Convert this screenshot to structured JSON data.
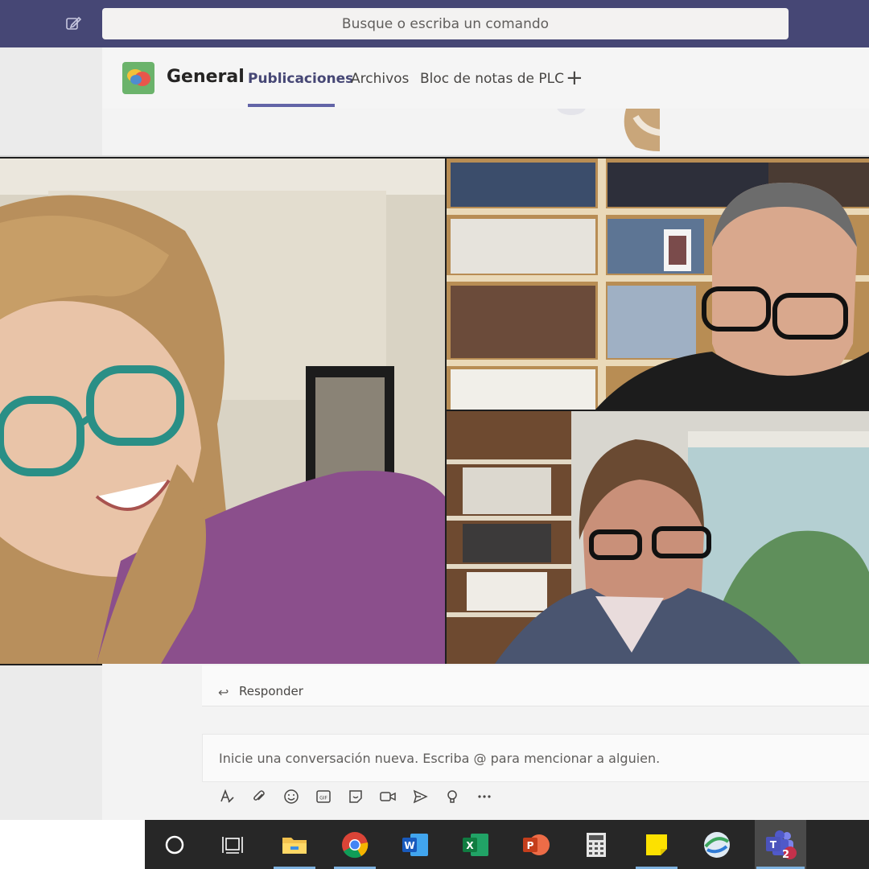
{
  "search": {
    "placeholder": "Busque o escriba un comando"
  },
  "channel": {
    "name": "General",
    "tabs": [
      {
        "label": "Publicaciones",
        "active": true
      },
      {
        "label": "Archivos",
        "active": false
      },
      {
        "label": "Bloc de notas de PLC",
        "active": false
      }
    ]
  },
  "post": {
    "reply_label": "Responder"
  },
  "composer": {
    "placeholder": "Inicie una conversación nueva. Escriba @ para mencionar a alguien."
  },
  "composer_tools": [
    "format-icon",
    "attach-icon",
    "emoji-icon",
    "gif-icon",
    "sticker-icon",
    "meet-now-icon",
    "send-icon",
    "praise-icon",
    "more-options-icon"
  ],
  "taskbar": {
    "apps": [
      "cortana",
      "task-view",
      "file-explorer",
      "chrome",
      "word",
      "excel",
      "powerpoint",
      "calculator",
      "sticky-notes",
      "network-app",
      "teams"
    ],
    "teams_badge": "2"
  },
  "colors": {
    "teams_purple": "#464775",
    "accent": "#6264a7"
  }
}
